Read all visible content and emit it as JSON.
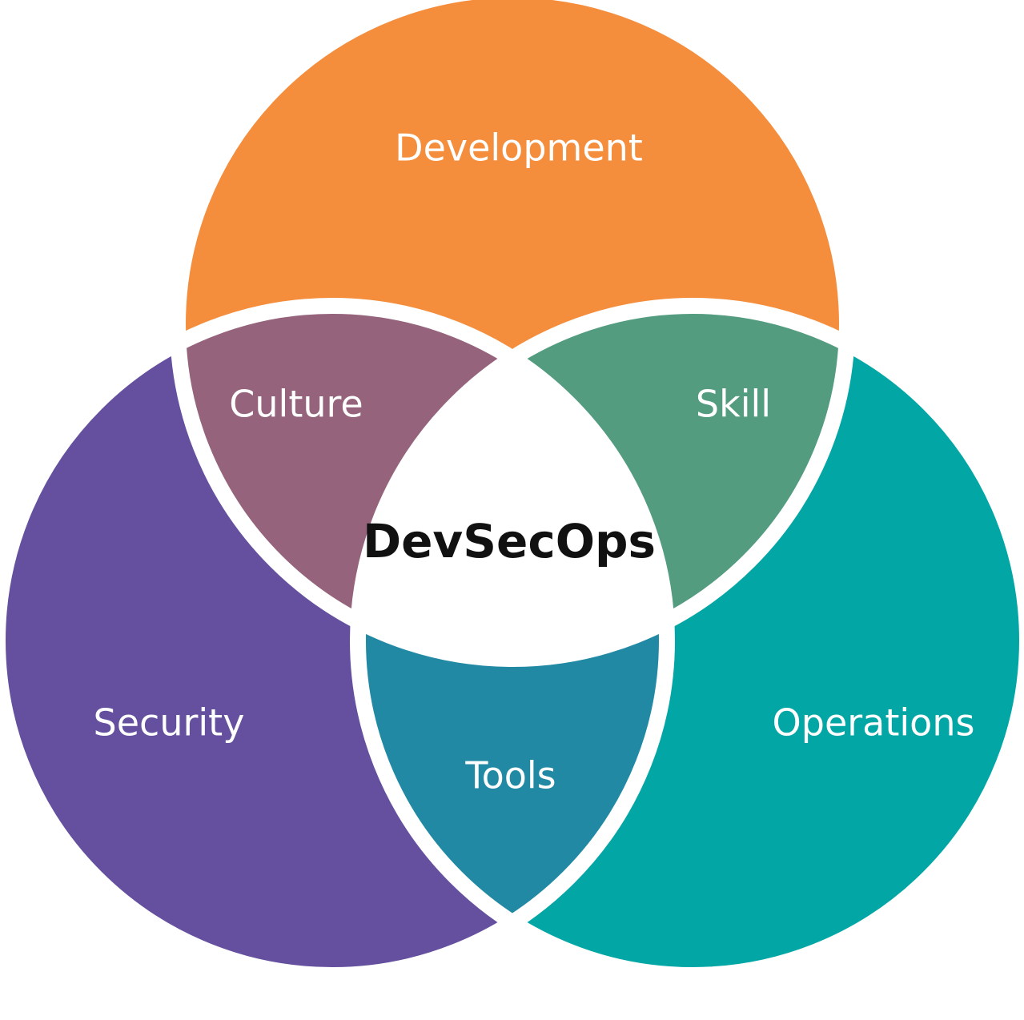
{
  "diagram": {
    "center": {
      "label": "DevSecOps"
    },
    "circles": {
      "development": {
        "label": "Development",
        "color": "#F48D3C"
      },
      "security": {
        "label": "Security",
        "color": "#65509F"
      },
      "operations": {
        "label": "Operations",
        "color": "#02A7A5"
      }
    },
    "overlaps": {
      "culture": {
        "label": "Culture",
        "color": "#95637B"
      },
      "skill": {
        "label": "Skill",
        "color": "#539C80"
      },
      "tools": {
        "label": "Tools",
        "color": "#2189A4"
      }
    }
  }
}
